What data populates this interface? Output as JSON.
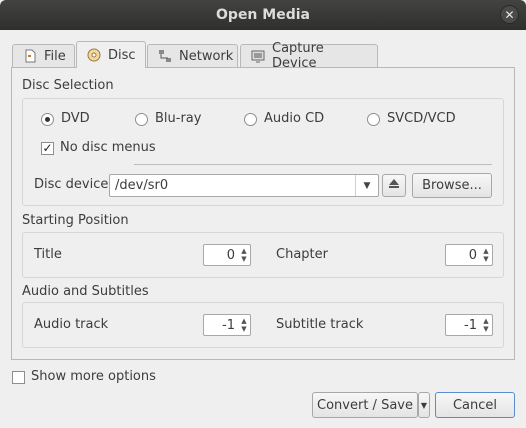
{
  "window": {
    "title": "Open Media"
  },
  "tabs": [
    {
      "label": "File",
      "icon": "file-icon"
    },
    {
      "label": "Disc",
      "icon": "disc-icon"
    },
    {
      "label": "Network",
      "icon": "network-icon"
    },
    {
      "label": "Capture Device",
      "icon": "capture-device-icon"
    }
  ],
  "disc_selection": {
    "heading": "Disc Selection",
    "options": [
      "DVD",
      "Blu-ray",
      "Audio CD",
      "SVCD/VCD"
    ],
    "selected": "DVD",
    "no_menus_label": "No disc menus",
    "no_menus_checked": true,
    "device_label": "Disc device",
    "device_value": "/dev/sr0",
    "browse_label": "Browse..."
  },
  "starting_position": {
    "heading": "Starting Position",
    "title_label": "Title",
    "title_value": "0",
    "chapter_label": "Chapter",
    "chapter_value": "0"
  },
  "audio_subtitles": {
    "heading": "Audio and Subtitles",
    "audio_label": "Audio track",
    "audio_value": "-1",
    "subtitle_label": "Subtitle track",
    "subtitle_value": "-1"
  },
  "footer": {
    "more_options_label": "Show more options",
    "more_options_checked": false,
    "convert_label": "Convert / Save",
    "cancel_label": "Cancel"
  },
  "colors": {
    "titlebar": "#3a3a38",
    "window_bg": "#efefef",
    "focus": "#5b8bd0"
  }
}
